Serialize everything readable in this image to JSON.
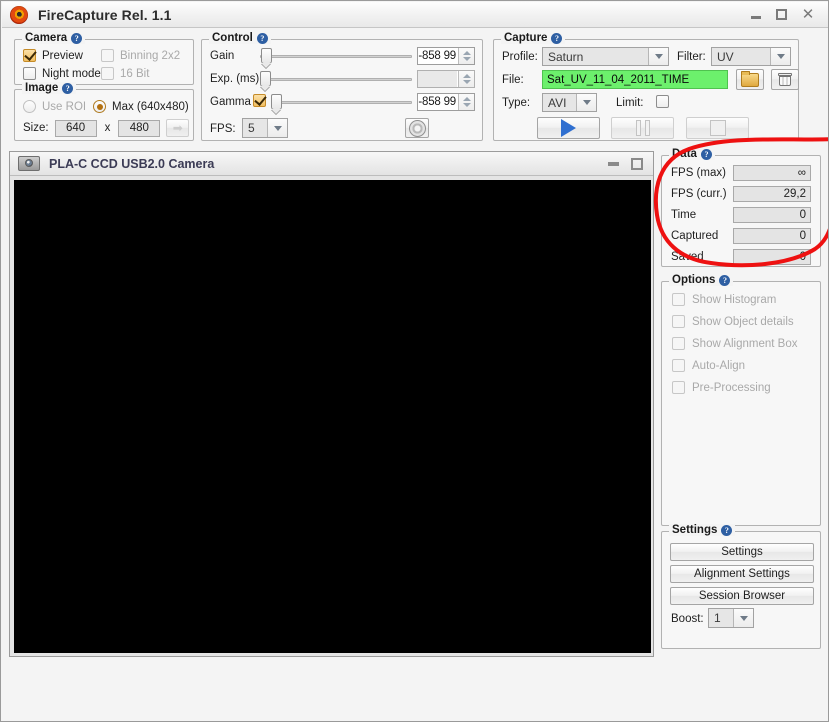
{
  "window": {
    "title": "FireCapture Rel. 1.1",
    "logo_icon": "firecapture-logo-icon",
    "minimize_label": "–",
    "maximize_label": "□",
    "close_label": "✕"
  },
  "help_glyph": "?",
  "camera_group": {
    "title": "Camera",
    "preview": {
      "label": "Preview",
      "checked": true,
      "enabled": true
    },
    "binning": {
      "label": "Binning 2x2",
      "checked": false,
      "enabled": false
    },
    "night_mode": {
      "label": "Night mode",
      "checked": false,
      "enabled": true
    },
    "sixteen_bit": {
      "label": "16 Bit",
      "checked": false,
      "enabled": false
    }
  },
  "image_group": {
    "title": "Image",
    "use_roi": {
      "label": "Use ROI",
      "selected": false
    },
    "max": {
      "label": "Max (640x480)",
      "selected": true
    },
    "size_label": "Size:",
    "width": "640",
    "x_label": "x",
    "height": "480",
    "apply_icon": "arrow-right-icon"
  },
  "control_group": {
    "title": "Control",
    "gain": {
      "label": "Gain",
      "value": "-858 99",
      "knob_pct": 2
    },
    "exposure": {
      "label": "Exp. (ms)",
      "value": "",
      "knob_pct": 1
    },
    "gamma": {
      "label": "Gamma",
      "checked": true,
      "value": "-858 99",
      "knob_pct": 1
    },
    "fps_label": "FPS:",
    "fps_value": "5",
    "settings_icon": "gear-icon"
  },
  "capture_group": {
    "title": "Capture",
    "profile_label": "Profile:",
    "profile_value": "Saturn",
    "filter_label": "Filter:",
    "filter_value": "UV",
    "file_label": "File:",
    "file_value": "Sat_UV_11_04_2011_TIME",
    "file_field_color": "#6cf06c",
    "browse_icon": "folder-icon",
    "delete_icon": "trash-icon",
    "type_label": "Type:",
    "type_value": "AVI",
    "limit_label": "Limit:",
    "limit_checked": false,
    "record_icon": "play-icon",
    "pause_icon": "pause-icon",
    "stop_icon": "stop-icon"
  },
  "camera_window": {
    "title": "PLA-C CCD USB2.0 Camera",
    "icon": "camera-icon",
    "minimize_label": "–",
    "maximize_label": "□",
    "video_background": "#000000"
  },
  "data_group": {
    "title": "Data",
    "rows": [
      {
        "label": "FPS (max)",
        "value": "∞"
      },
      {
        "label": "FPS (curr.)",
        "value": "29,2"
      },
      {
        "label": "Time",
        "value": "0"
      },
      {
        "label": "Captured",
        "value": "0"
      },
      {
        "label": "Saved",
        "value": "0"
      }
    ]
  },
  "annotation": {
    "shape": "hand-drawn-red-circle",
    "color": "#ee1111",
    "target": "data-group"
  },
  "options_group": {
    "title": "Options",
    "items": [
      {
        "label": "Show Histogram",
        "checked": false
      },
      {
        "label": "Show Object details",
        "checked": false
      },
      {
        "label": "Show Alignment Box",
        "checked": false
      },
      {
        "label": "Auto-Align",
        "checked": false
      },
      {
        "label": "Pre-Processing",
        "checked": false
      }
    ]
  },
  "settings_group": {
    "title": "Settings",
    "buttons": [
      "Settings",
      "Alignment Settings",
      "Session Browser"
    ],
    "boost_label": "Boost:",
    "boost_value": "1"
  }
}
